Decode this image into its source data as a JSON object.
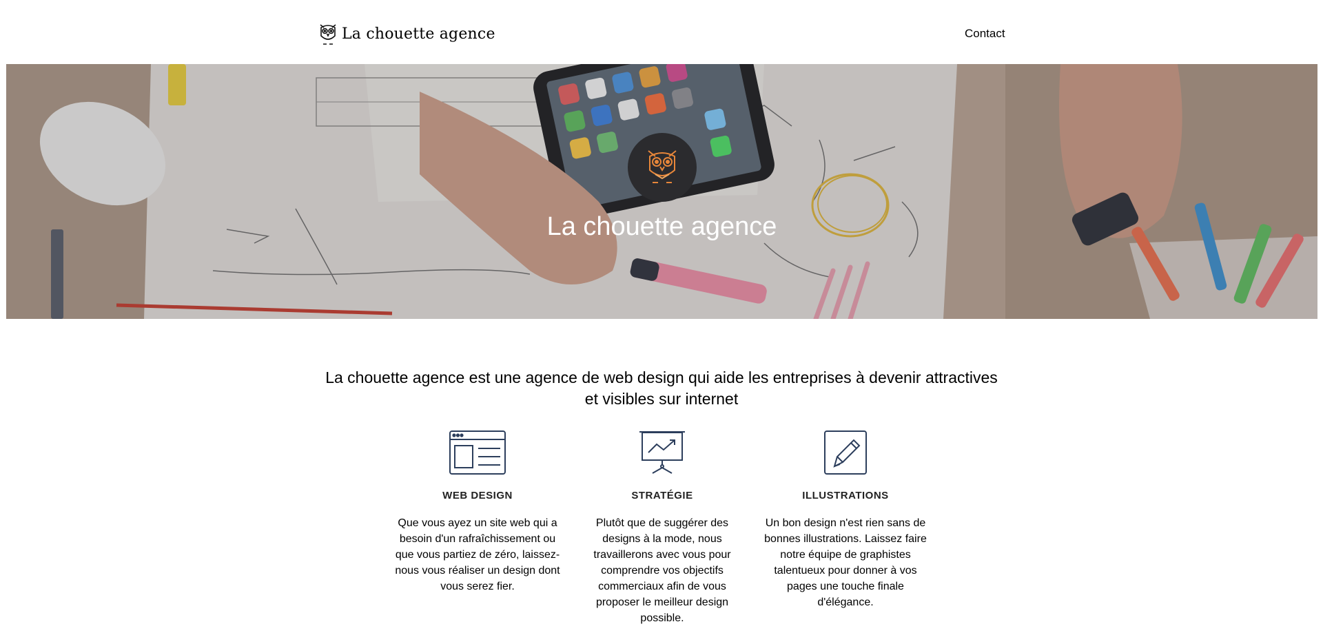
{
  "header": {
    "brand": "La chouette agence",
    "nav": {
      "contact": "Contact"
    }
  },
  "hero": {
    "title": "La chouette agence",
    "badge_icon": "owl-logo-icon"
  },
  "intro": {
    "tagline": "La chouette agence est une agence de web design qui aide les entreprises à devenir attractives et visibles sur internet"
  },
  "services": [
    {
      "icon": "browser-window-icon",
      "title": "WEB DESIGN",
      "text": "Que vous ayez un site web qui a besoin d'un rafraîchissement ou que vous partiez de zéro, laissez-nous vous réaliser un design dont vous serez fier."
    },
    {
      "icon": "presentation-chart-icon",
      "title": "STRATÉGIE",
      "text": "Plutôt que de suggérer des designs à la mode, nous travaillerons avec vous pour comprendre vos objectifs commerciaux afin de vous proposer le meilleur design possible."
    },
    {
      "icon": "pencil-icon",
      "title": "ILLUSTRATIONS",
      "text": "Un bon design n'est rien sans de bonnes illustrations. Laissez faire notre équipe de graphistes talentueux pour donner à vos pages une touche finale d'élégance."
    }
  ],
  "colors": {
    "icon_stroke": "#2c3e5c",
    "owl_accent": "#e8873a",
    "badge_bg": "#2b2b2e"
  }
}
